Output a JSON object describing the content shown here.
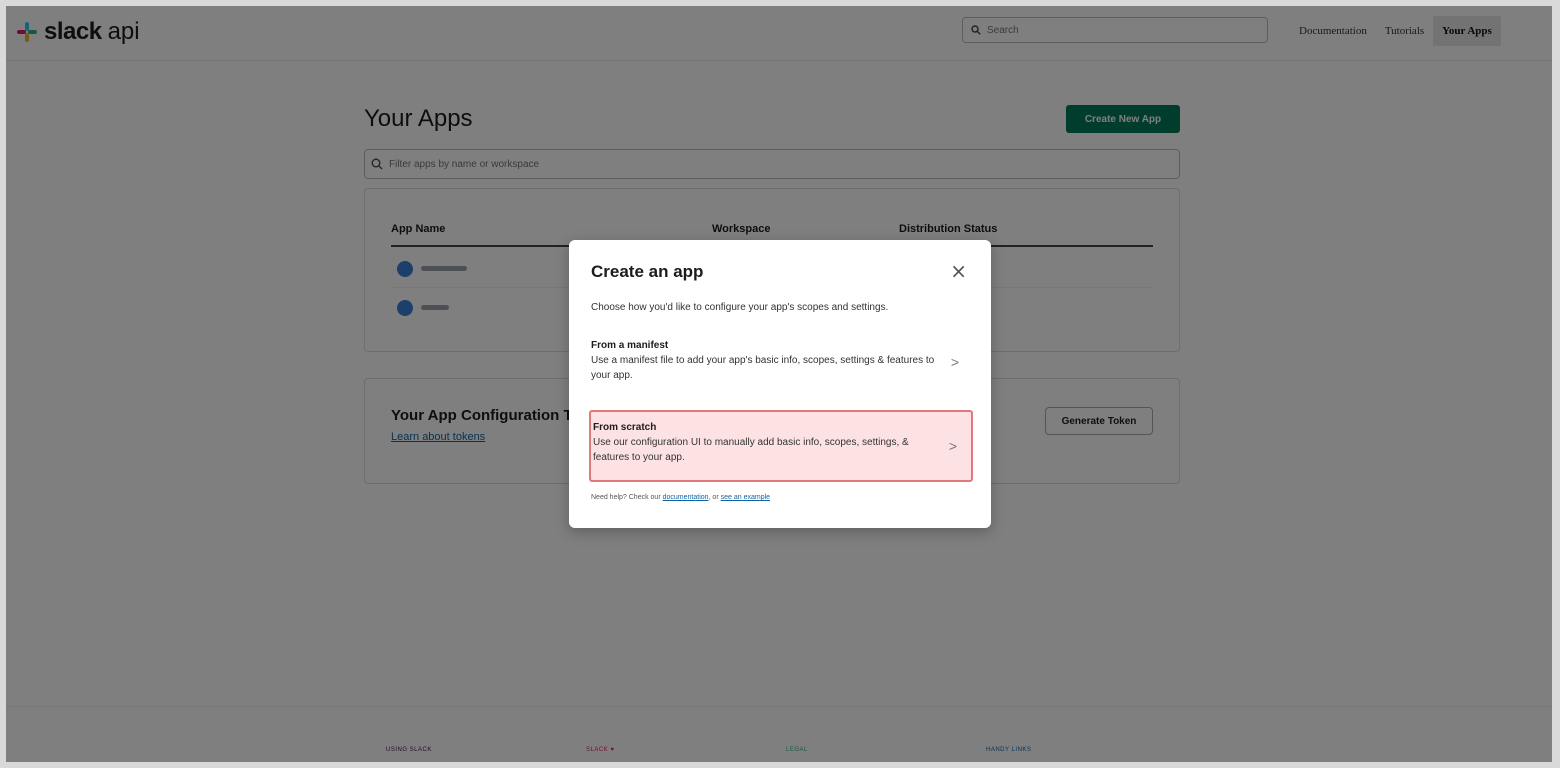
{
  "header": {
    "brand": "slack",
    "brand_suffix": "api",
    "search_placeholder": "Search",
    "nav": [
      "Documentation",
      "Tutorials",
      "Your Apps"
    ]
  },
  "main": {
    "title": "Your Apps",
    "create_button": "Create New App",
    "filter_placeholder": "Filter apps by name or workspace",
    "table_headers": [
      "App Name",
      "Workspace",
      "Distribution Status"
    ],
    "token_card": {
      "title": "Your App Configuration T",
      "link": "Learn about tokens",
      "button": "Generate Token"
    }
  },
  "footer": {
    "columns": [
      "USING SLACK",
      "SLACK ♥",
      "LEGAL",
      "HANDY LINKS"
    ]
  },
  "modal": {
    "title": "Create an app",
    "description": "Choose how you'd like to configure your app's scopes and settings.",
    "options": [
      {
        "title": "From a manifest",
        "description": "Use a manifest file to add your app's basic info, scopes, settings & features to your app."
      },
      {
        "title": "From scratch",
        "description": "Use our configuration UI to manually add basic info, scopes, settings, & features to your app."
      }
    ],
    "help_prefix": "Need help? Check our",
    "help_link1": "documentation",
    "help_mid": ", or",
    "help_link2": "see an example"
  },
  "colors": {
    "brand_green": "#007a5a",
    "highlight_border": "#e2777c",
    "highlight_fill": "#fde2e3",
    "link_blue": "#1264a3"
  }
}
